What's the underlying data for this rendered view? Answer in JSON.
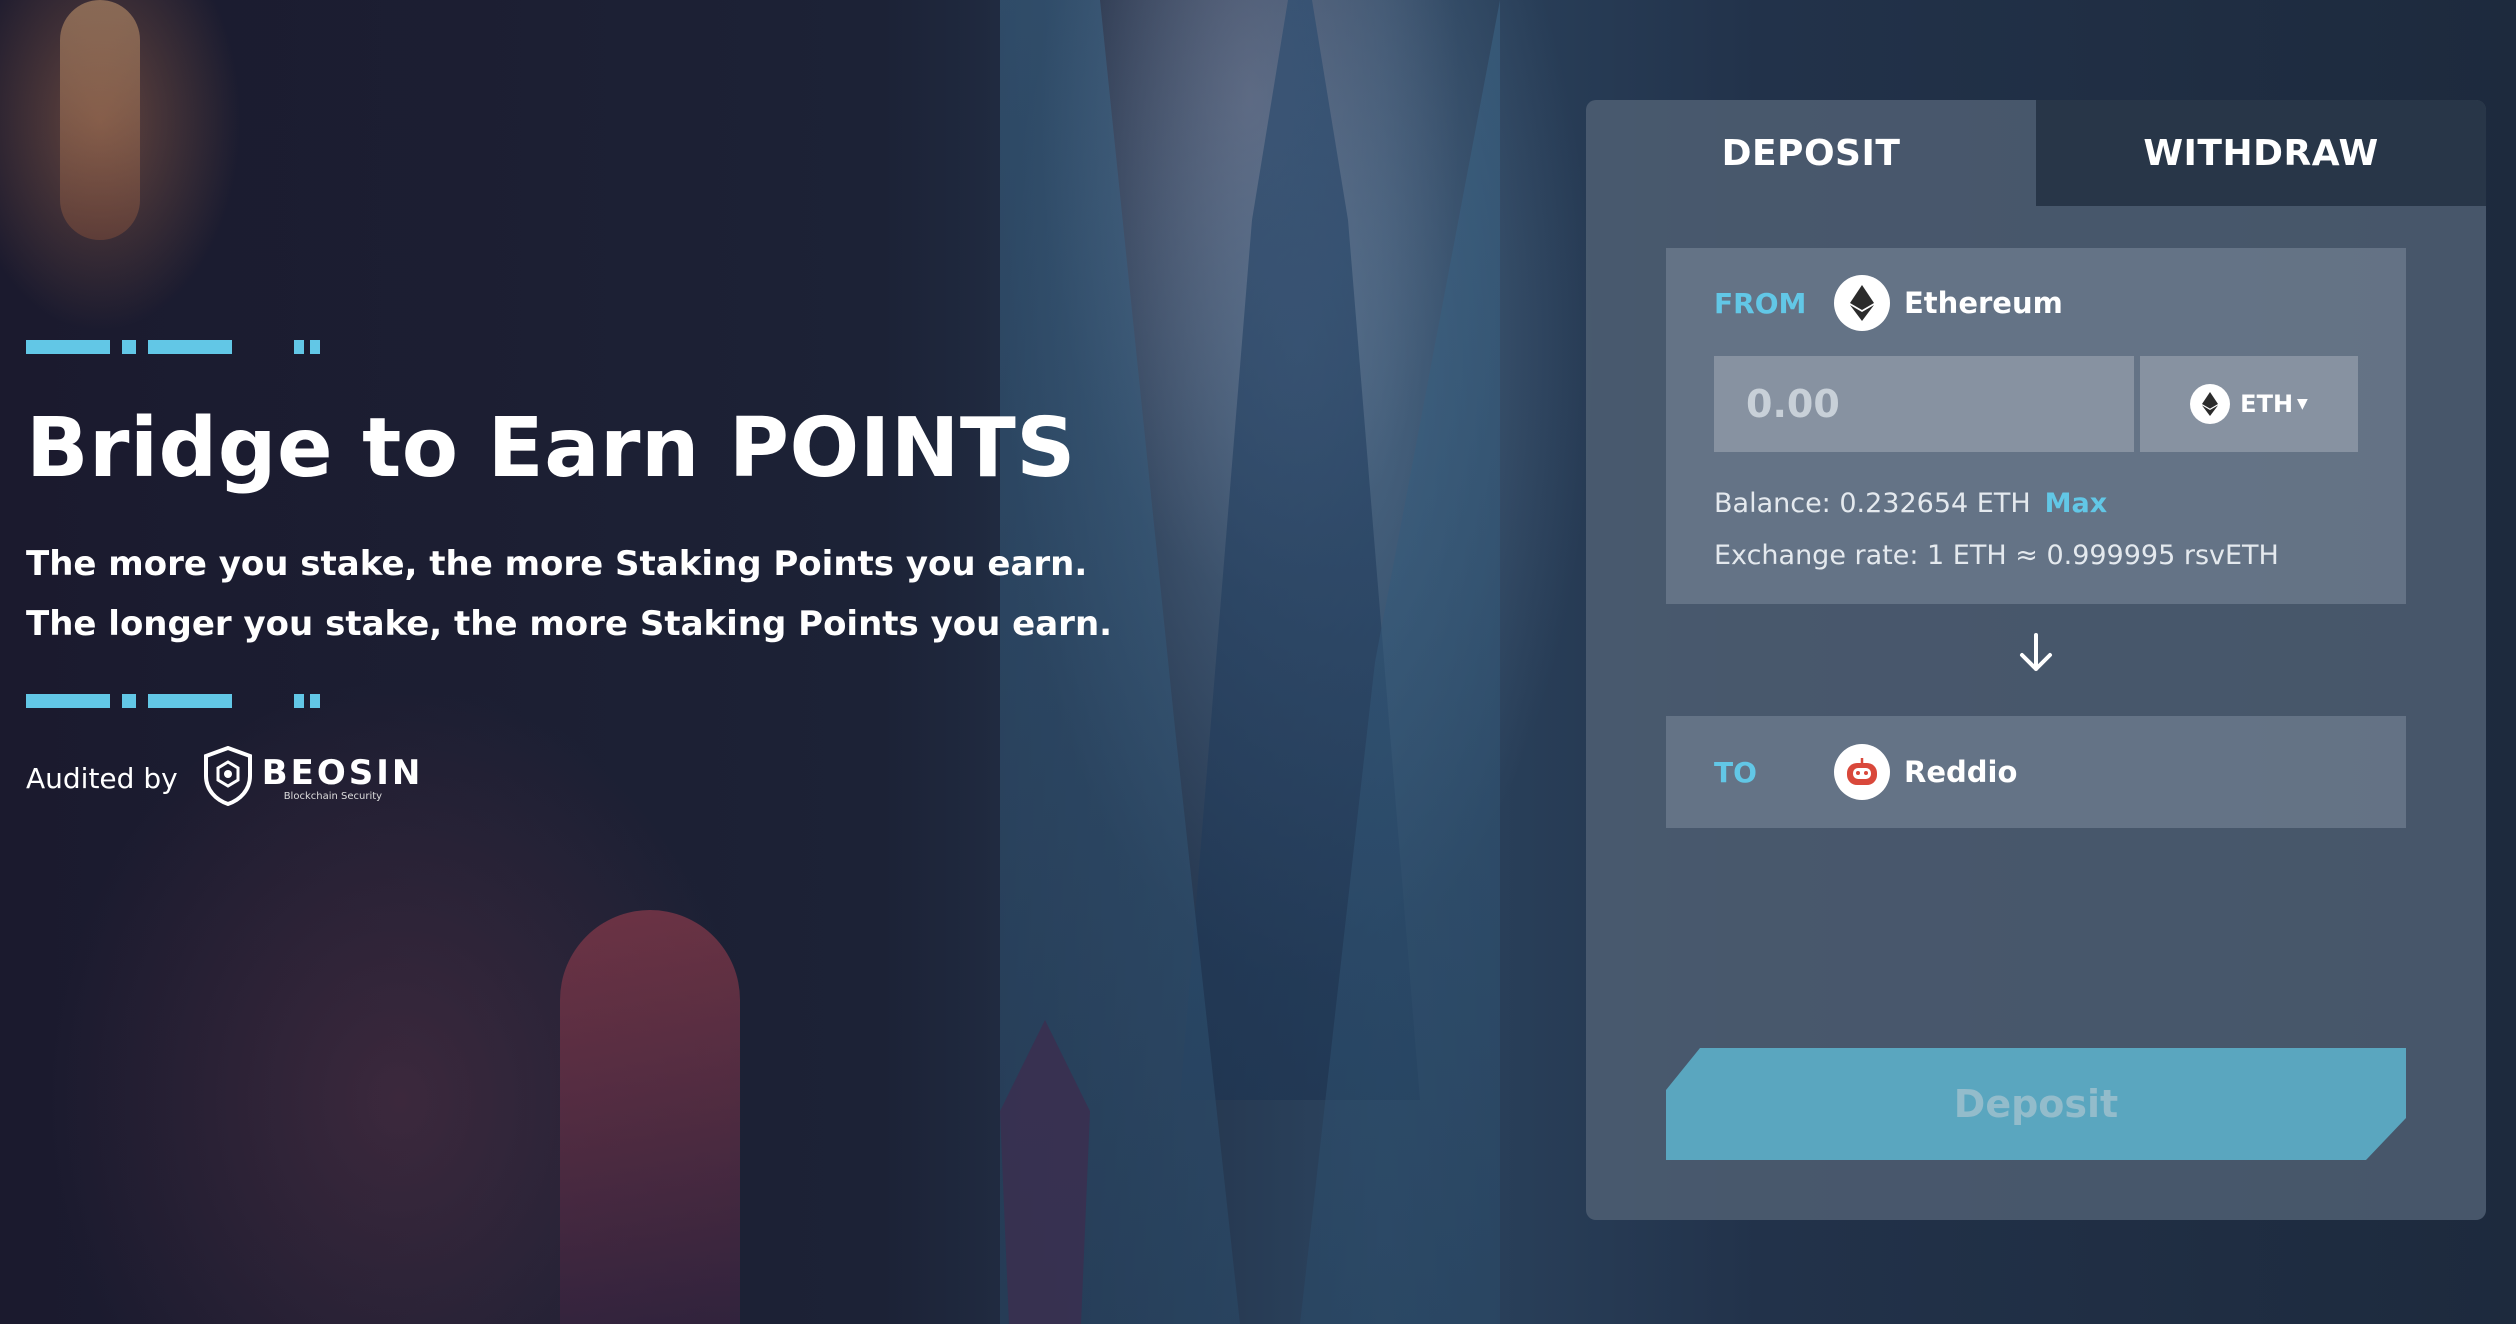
{
  "hero": {
    "title": "Bridge to Earn POINTS",
    "line1": "The more you stake, the more Staking Points you earn.",
    "line2": "The longer you stake, the more Staking Points you earn.",
    "audited_label": "Audited by",
    "auditor_name": "BEOSIN",
    "auditor_tagline": "Blockchain Security"
  },
  "panel": {
    "tabs": [
      {
        "label": "DEPOSIT",
        "active": true
      },
      {
        "label": "WITHDRAW",
        "active": false
      }
    ],
    "from": {
      "label": "FROM",
      "chain": "Ethereum",
      "chain_icon": "ethereum-icon",
      "amount_placeholder": "0.00",
      "token": "ETH",
      "balance_text": "Balance: 0.232654 ETH",
      "max_label": "Max",
      "rate_text": "Exchange rate: 1 ETH ≈ 0.999995 rsvETH"
    },
    "to": {
      "label": "TO",
      "chain": "Reddio",
      "chain_icon": "reddio-icon"
    },
    "submit_label": "Deposit"
  },
  "colors": {
    "accent": "#62c7e6",
    "button": "#5aa6bf",
    "panel": "#50607a",
    "tab_inactive": "#233042"
  }
}
